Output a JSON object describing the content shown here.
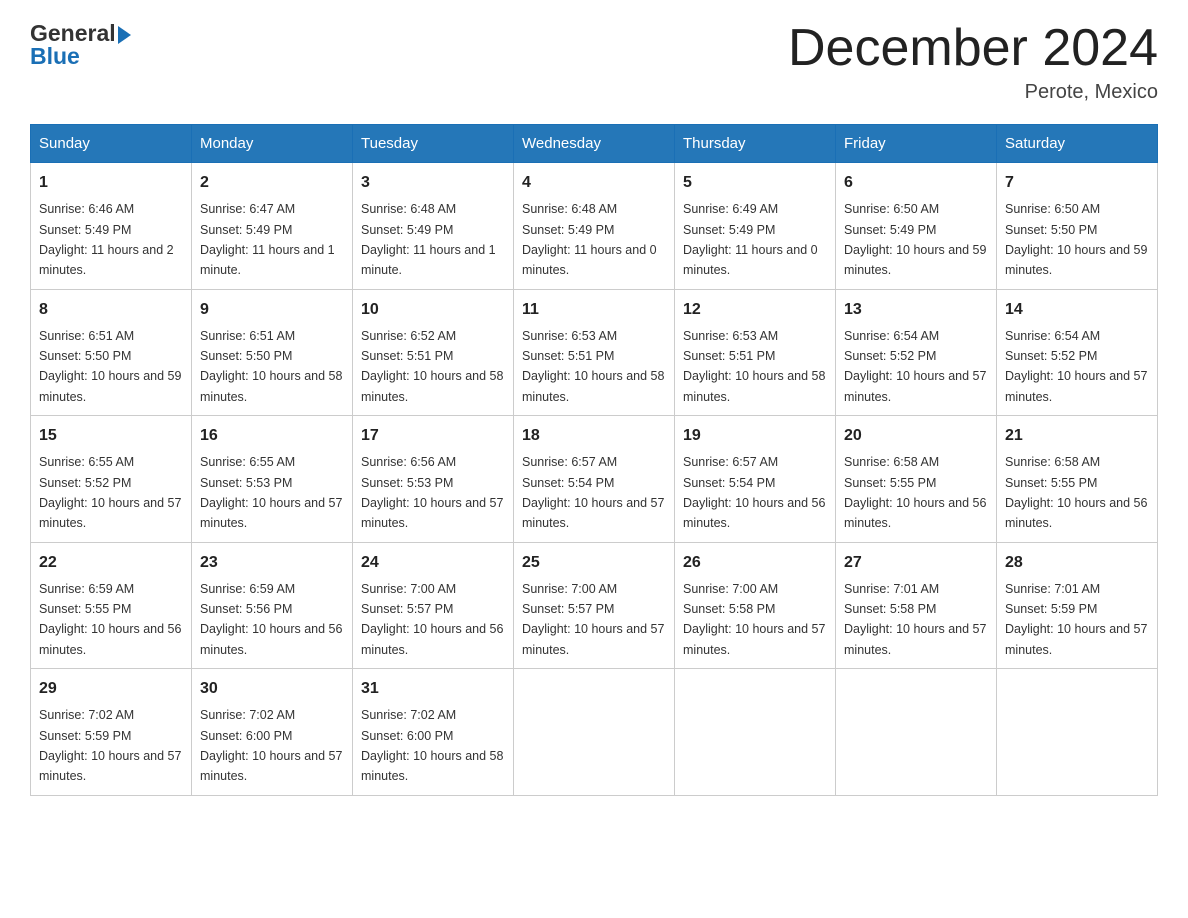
{
  "header": {
    "logo_general": "General",
    "logo_blue": "Blue",
    "month_title": "December 2024",
    "location": "Perote, Mexico"
  },
  "days_of_week": [
    "Sunday",
    "Monday",
    "Tuesday",
    "Wednesday",
    "Thursday",
    "Friday",
    "Saturday"
  ],
  "weeks": [
    [
      {
        "day": "1",
        "sunrise": "6:46 AM",
        "sunset": "5:49 PM",
        "daylight": "11 hours and 2 minutes."
      },
      {
        "day": "2",
        "sunrise": "6:47 AM",
        "sunset": "5:49 PM",
        "daylight": "11 hours and 1 minute."
      },
      {
        "day": "3",
        "sunrise": "6:48 AM",
        "sunset": "5:49 PM",
        "daylight": "11 hours and 1 minute."
      },
      {
        "day": "4",
        "sunrise": "6:48 AM",
        "sunset": "5:49 PM",
        "daylight": "11 hours and 0 minutes."
      },
      {
        "day": "5",
        "sunrise": "6:49 AM",
        "sunset": "5:49 PM",
        "daylight": "11 hours and 0 minutes."
      },
      {
        "day": "6",
        "sunrise": "6:50 AM",
        "sunset": "5:49 PM",
        "daylight": "10 hours and 59 minutes."
      },
      {
        "day": "7",
        "sunrise": "6:50 AM",
        "sunset": "5:50 PM",
        "daylight": "10 hours and 59 minutes."
      }
    ],
    [
      {
        "day": "8",
        "sunrise": "6:51 AM",
        "sunset": "5:50 PM",
        "daylight": "10 hours and 59 minutes."
      },
      {
        "day": "9",
        "sunrise": "6:51 AM",
        "sunset": "5:50 PM",
        "daylight": "10 hours and 58 minutes."
      },
      {
        "day": "10",
        "sunrise": "6:52 AM",
        "sunset": "5:51 PM",
        "daylight": "10 hours and 58 minutes."
      },
      {
        "day": "11",
        "sunrise": "6:53 AM",
        "sunset": "5:51 PM",
        "daylight": "10 hours and 58 minutes."
      },
      {
        "day": "12",
        "sunrise": "6:53 AM",
        "sunset": "5:51 PM",
        "daylight": "10 hours and 58 minutes."
      },
      {
        "day": "13",
        "sunrise": "6:54 AM",
        "sunset": "5:52 PM",
        "daylight": "10 hours and 57 minutes."
      },
      {
        "day": "14",
        "sunrise": "6:54 AM",
        "sunset": "5:52 PM",
        "daylight": "10 hours and 57 minutes."
      }
    ],
    [
      {
        "day": "15",
        "sunrise": "6:55 AM",
        "sunset": "5:52 PM",
        "daylight": "10 hours and 57 minutes."
      },
      {
        "day": "16",
        "sunrise": "6:55 AM",
        "sunset": "5:53 PM",
        "daylight": "10 hours and 57 minutes."
      },
      {
        "day": "17",
        "sunrise": "6:56 AM",
        "sunset": "5:53 PM",
        "daylight": "10 hours and 57 minutes."
      },
      {
        "day": "18",
        "sunrise": "6:57 AM",
        "sunset": "5:54 PM",
        "daylight": "10 hours and 57 minutes."
      },
      {
        "day": "19",
        "sunrise": "6:57 AM",
        "sunset": "5:54 PM",
        "daylight": "10 hours and 56 minutes."
      },
      {
        "day": "20",
        "sunrise": "6:58 AM",
        "sunset": "5:55 PM",
        "daylight": "10 hours and 56 minutes."
      },
      {
        "day": "21",
        "sunrise": "6:58 AM",
        "sunset": "5:55 PM",
        "daylight": "10 hours and 56 minutes."
      }
    ],
    [
      {
        "day": "22",
        "sunrise": "6:59 AM",
        "sunset": "5:55 PM",
        "daylight": "10 hours and 56 minutes."
      },
      {
        "day": "23",
        "sunrise": "6:59 AM",
        "sunset": "5:56 PM",
        "daylight": "10 hours and 56 minutes."
      },
      {
        "day": "24",
        "sunrise": "7:00 AM",
        "sunset": "5:57 PM",
        "daylight": "10 hours and 56 minutes."
      },
      {
        "day": "25",
        "sunrise": "7:00 AM",
        "sunset": "5:57 PM",
        "daylight": "10 hours and 57 minutes."
      },
      {
        "day": "26",
        "sunrise": "7:00 AM",
        "sunset": "5:58 PM",
        "daylight": "10 hours and 57 minutes."
      },
      {
        "day": "27",
        "sunrise": "7:01 AM",
        "sunset": "5:58 PM",
        "daylight": "10 hours and 57 minutes."
      },
      {
        "day": "28",
        "sunrise": "7:01 AM",
        "sunset": "5:59 PM",
        "daylight": "10 hours and 57 minutes."
      }
    ],
    [
      {
        "day": "29",
        "sunrise": "7:02 AM",
        "sunset": "5:59 PM",
        "daylight": "10 hours and 57 minutes."
      },
      {
        "day": "30",
        "sunrise": "7:02 AM",
        "sunset": "6:00 PM",
        "daylight": "10 hours and 57 minutes."
      },
      {
        "day": "31",
        "sunrise": "7:02 AM",
        "sunset": "6:00 PM",
        "daylight": "10 hours and 58 minutes."
      },
      null,
      null,
      null,
      null
    ]
  ]
}
